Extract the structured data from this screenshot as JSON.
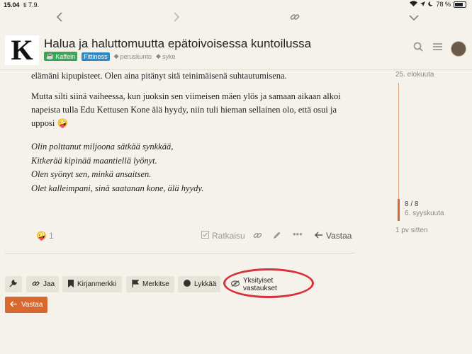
{
  "status_bar": {
    "time": "15.04",
    "date": "ti 7.9.",
    "battery": "78 %"
  },
  "topic": {
    "logo_letter": "K",
    "title": "Halua ja haluttomuutta epätoivoisessa kuntoilussa",
    "badges": [
      {
        "label": "Kaffein",
        "color": "#3aa655"
      },
      {
        "label": "Fittiness",
        "color": "#2e8bc9"
      }
    ],
    "tags": [
      "peruskunto",
      "syke"
    ]
  },
  "post": {
    "p1": "elämäni kipupisteet. Olen aina pitänyt sitä teinimäisenä suhtautumisena.",
    "p2": "Mutta silti siinä vaiheessa, kun juoksin sen viimeisen mäen ylös ja samaan aikaan alkoi napeista tulla Edu Kettusen Kone älä hyydy, niin tuli hieman sellainen olo, että osui ja upposi",
    "emoji": "🤪",
    "poem": [
      "Olin polttanut miljoona sätkää synkkää,",
      "Kitkerää kipinää maantiellä lyönyt.",
      "Olen syönyt sen, minkä ansaitsen.",
      "Olet kalleimpani, sinä saatanan kone, älä hyydy."
    ]
  },
  "actions": {
    "reaction_emoji": "🤪",
    "reaction_count": "1",
    "solution_label": "Ratkaisu",
    "reply_label": "Vastaa"
  },
  "timeline": {
    "start_date": "25. elokuuta",
    "position": "8 / 8",
    "current_date": "6. syyskuuta",
    "ago": "1 pv sitten"
  },
  "footer": {
    "buttons": [
      "Jaa",
      "Kirjanmerkki",
      "Merkitse",
      "Lykkää",
      "Yksityiset vastaukset"
    ],
    "reply_label": "Vastaa"
  },
  "colors": {
    "accent": "#d7692e",
    "highlight_ring": "#d8303f"
  }
}
